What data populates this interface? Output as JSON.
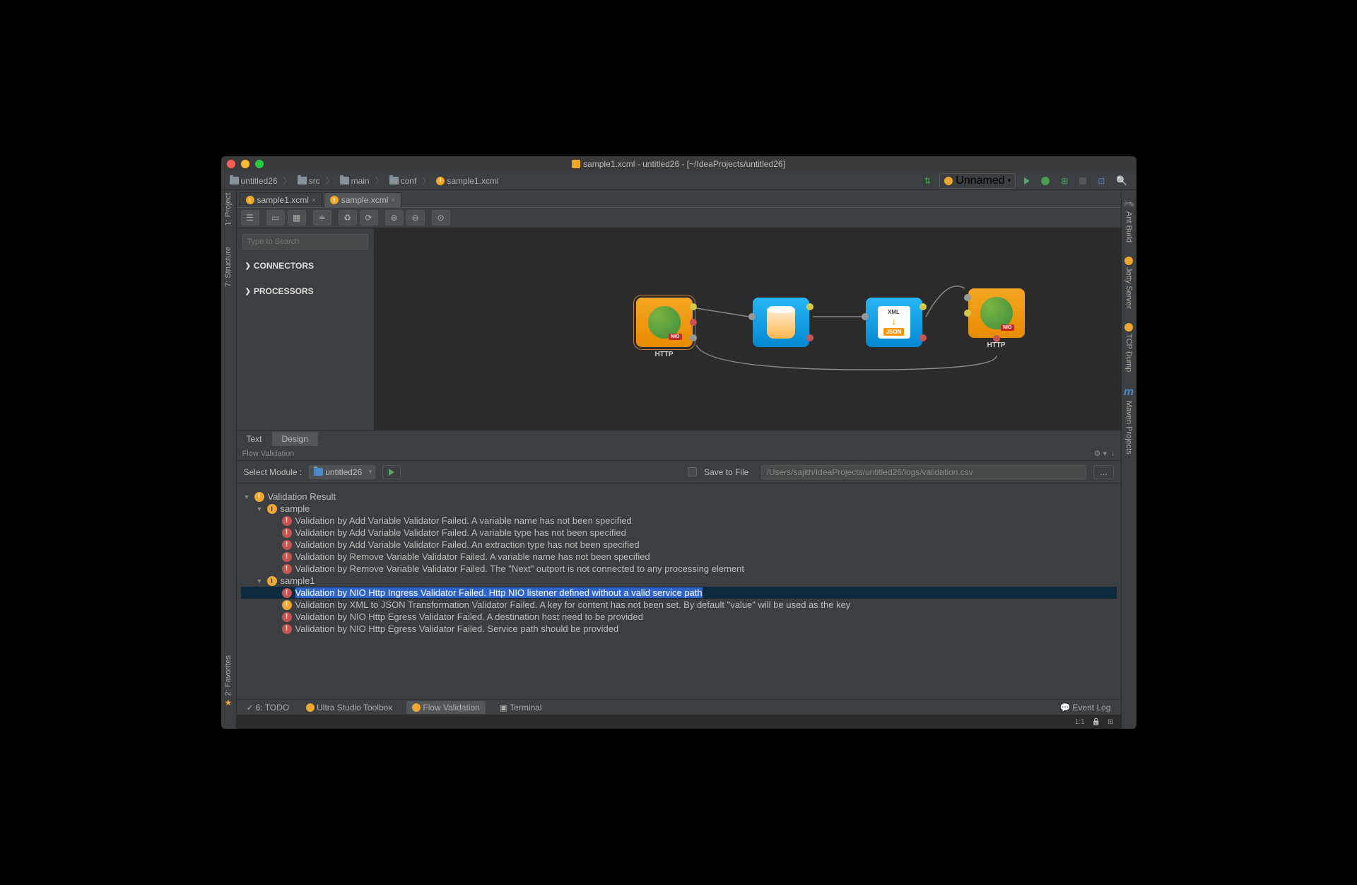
{
  "title": "sample1.xcml - untitled26 - [~/IdeaProjects/untitled26]",
  "breadcrumbs": [
    "untitled26",
    "src",
    "main",
    "conf",
    "sample1.xcml"
  ],
  "runConfig": "Unnamed",
  "tabs": [
    {
      "label": "sample1.xcml",
      "active": false
    },
    {
      "label": "sample.xcml",
      "active": true
    }
  ],
  "palette": {
    "searchPlaceholder": "Type to Search",
    "sections": [
      "CONNECTORS",
      "PROCESSORS"
    ]
  },
  "nodes": {
    "n1_label": "HTTP",
    "n4_label": "HTTP",
    "xml_top": "XML",
    "xml_bot": "JSON"
  },
  "bottomTabs": [
    "Text",
    "Design"
  ],
  "panelTitle": "Flow Validation",
  "moduleRow": {
    "label": "Select Module :",
    "value": "untitled26",
    "saveToFile": "Save to File",
    "path": "/Users/sajith/IdeaProjects/untitled26/logs/validation.csv",
    "browse": "..."
  },
  "resultsRoot": "Validation Result",
  "resultGroups": [
    {
      "name": "sample",
      "items": [
        {
          "sev": "err",
          "text": "Validation by Add Variable Validator Failed. A variable name has not been specified"
        },
        {
          "sev": "err",
          "text": "Validation by Add Variable Validator Failed. A variable type has not been specified"
        },
        {
          "sev": "err",
          "text": "Validation by Add Variable Validator Failed. An extraction type has not been specified"
        },
        {
          "sev": "err",
          "text": "Validation by Remove Variable Validator Failed. A variable name has not been specified"
        },
        {
          "sev": "err",
          "text": "Validation by Remove Variable Validator Failed. The \"Next\" outport is not connected to any processing element"
        }
      ]
    },
    {
      "name": "sample1",
      "items": [
        {
          "sev": "err",
          "text": "Validation by NIO Http Ingress Validator Failed. Http NIO listener defined without a valid service path",
          "selected": true
        },
        {
          "sev": "warn",
          "text": "Validation by XML to JSON Transformation Validator Failed. A key for content has not been set. By default \"value\" will be used as the key"
        },
        {
          "sev": "err",
          "text": "Validation by NIO Http Egress Validator Failed. A destination host need to be provided"
        },
        {
          "sev": "err",
          "text": "Validation by NIO Http Egress Validator Failed. Service path should be provided"
        }
      ]
    }
  ],
  "statusItems": [
    "6: TODO",
    "Ultra Studio Toolbox",
    "Flow Validation",
    "Terminal"
  ],
  "eventLog": "Event Log",
  "cursorPos": "1:1",
  "leftGutter": [
    "1: Project",
    "7: Structure",
    "2: Favorites"
  ],
  "rightGutter": [
    "Ant Build",
    "Jetty Server",
    "TCP Dump",
    "Maven Projects"
  ]
}
